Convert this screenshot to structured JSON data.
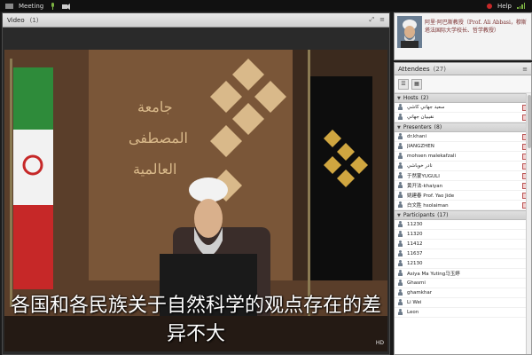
{
  "topbar": {
    "meeting_label": "Meeting",
    "help_label": "Help",
    "icons": [
      "mic-icon",
      "camera-icon",
      "status-icon",
      "signal-icon"
    ]
  },
  "video_pod": {
    "title": "Video",
    "count": "(1)",
    "subtitle": "各国和各民族关于自然科学的观点存在的差异不大",
    "hd_label": "HD"
  },
  "speaker": {
    "caption": "阿里·阿巴斯教授（Prof. Ali Abbasi，穆斯塔法国际大学校长、哲学教授）"
  },
  "attendees": {
    "title": "Attendees",
    "count": "(27)",
    "sections": [
      {
        "name": "Hosts",
        "count": "(2)",
        "rows": [
          "سعيد جهاني کاشي",
          "نقيبيان جهاني"
        ]
      },
      {
        "name": "Presenters",
        "count": "(8)",
        "rows": [
          "dr.khani",
          "JIANGZHEN",
          "mohsen malekafzali",
          "نادر خوباشي",
          "于然蒙YUGULI",
          "黄开法-khaiyan",
          "姚建春 Prof. Yao Jide",
          "白文胜 hsolaiman"
        ]
      },
      {
        "name": "Participants",
        "count": "(17)",
        "rows": [
          "11230",
          "11320",
          "11412",
          "11637",
          "12130",
          "Asiya Ma Yuting马玉婷",
          "Ghasmi",
          "ghamkhar",
          "Li Wei",
          "Leon"
        ]
      }
    ]
  },
  "colors": {
    "caption_text": "#7a2e2e",
    "topbar_bg": "#111111"
  }
}
